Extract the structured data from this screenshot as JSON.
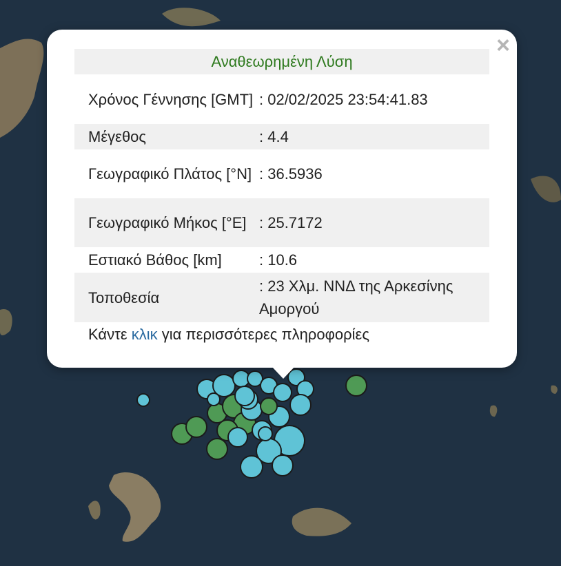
{
  "popup": {
    "close_icon": "×",
    "title": "Αναθεωρημένη Λύση",
    "rows": [
      {
        "label": "Χρόνος Γέννησης [GMT]",
        "value": ": 02/02/2025 23:54:41.83"
      },
      {
        "label": "Μέγεθος",
        "value": ": 4.4"
      },
      {
        "label": "Γεωγραφικό Πλάτος [°N]",
        "value": ": 36.5936"
      },
      {
        "label": "Γεωγραφικό Μήκος [°E]",
        "value": ": 25.7172"
      },
      {
        "label": "Εστιακό Βάθος [km]",
        "value": ": 10.6"
      },
      {
        "label": "Τοποθεσία",
        "value": ": 23 Χλμ. ΝΝΔ της Αρκεσίνης Αμοργού"
      }
    ],
    "footer_pre": "Κάντε ",
    "footer_link": "κλικ",
    "footer_post": " για περισσότερες πληροφορίες"
  },
  "colors": {
    "sea": "#1f3143",
    "land": "#7d7058",
    "marker_cyan": "#5fc3d6",
    "marker_green": "#4f9a55",
    "title_green": "#2f7a1f",
    "link_blue": "#2a6aa0"
  }
}
